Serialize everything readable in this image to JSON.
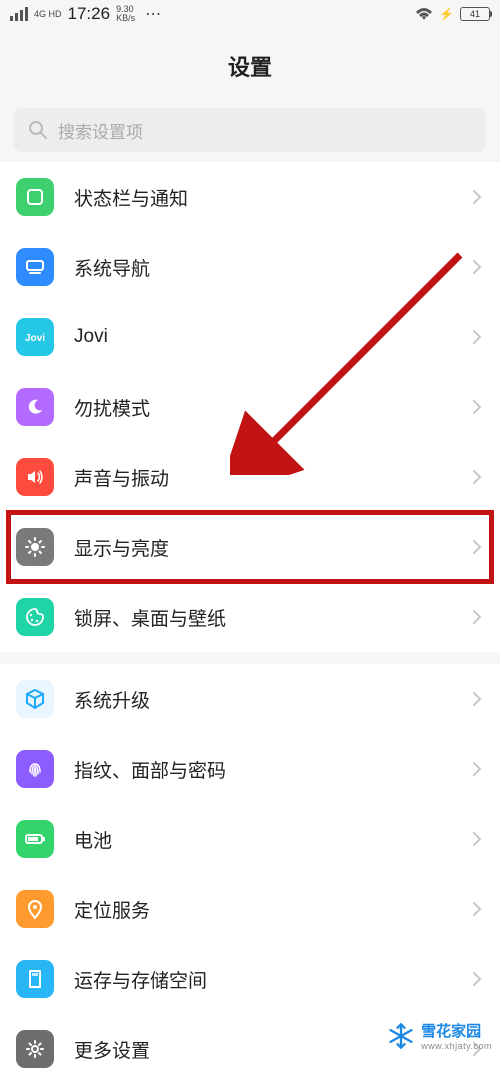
{
  "statusBar": {
    "signalMode": "4G HD",
    "time": "17:26",
    "dataRate": "9.30",
    "dataUnit": "KB/s",
    "batteryPct": "41"
  },
  "title": "设置",
  "search": {
    "placeholder": "搜索设置项"
  },
  "groups": [
    {
      "items": [
        {
          "key": "status-notify",
          "label": "状态栏与通知",
          "iconColor": "#3ed06e",
          "icon": "square-icon"
        },
        {
          "key": "nav",
          "label": "系统导航",
          "iconColor": "#2f8cff",
          "icon": "nav-icon"
        },
        {
          "key": "jovi",
          "label": "Jovi",
          "iconColor": "#25c7e6",
          "icon": "jovi-icon"
        },
        {
          "key": "dnd",
          "label": "勿扰模式",
          "iconColor": "#b36bff",
          "icon": "moon-icon"
        },
        {
          "key": "sound",
          "label": "声音与振动",
          "iconColor": "#ff4b3e",
          "icon": "speaker-icon"
        },
        {
          "key": "display",
          "label": "显示与亮度",
          "iconColor": "#7a7a7a",
          "icon": "brightness-icon",
          "highlighted": true
        },
        {
          "key": "lockscreen",
          "label": "锁屏、桌面与壁纸",
          "iconColor": "#1fd4a7",
          "icon": "palette-icon"
        }
      ]
    },
    {
      "items": [
        {
          "key": "update",
          "label": "系统升级",
          "iconColor": "#1fa8ff",
          "icon": "cube-icon"
        },
        {
          "key": "biometrics",
          "label": "指纹、面部与密码",
          "iconColor": "#8c5cff",
          "icon": "fingerprint-icon"
        },
        {
          "key": "battery",
          "label": "电池",
          "iconColor": "#33d46b",
          "icon": "battery-icon"
        },
        {
          "key": "location",
          "label": "定位服务",
          "iconColor": "#ff9a2e",
          "icon": "pin-icon"
        },
        {
          "key": "storage",
          "label": "运存与存储空间",
          "iconColor": "#29b6f6",
          "icon": "sd-icon"
        },
        {
          "key": "more",
          "label": "更多设置",
          "iconColor": "#6e6e6e",
          "icon": "gear-icon"
        }
      ]
    }
  ],
  "watermark": {
    "trUrl": "www.xhjaty.com",
    "brText": "雪花家园",
    "brUrl": "www.xhjaty.com"
  }
}
